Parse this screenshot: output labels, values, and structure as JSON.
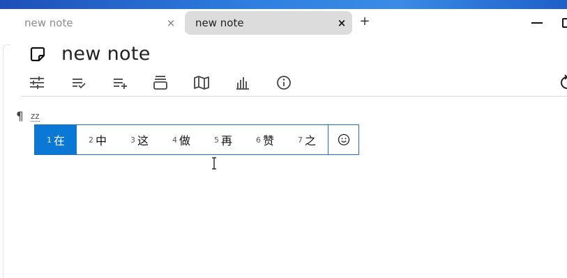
{
  "tabs": [
    {
      "label": "new note",
      "close": "×",
      "active": false
    },
    {
      "label": "new note",
      "close": "×",
      "active": true
    }
  ],
  "new_tab_label": "+",
  "note": {
    "title": "new note"
  },
  "toolbar_icons": [
    "sliders-icon",
    "checklist-icon",
    "add-list-icon",
    "archive-icon",
    "map-icon",
    "bar-chart-icon",
    "info-icon",
    "refresh-icon"
  ],
  "editor": {
    "pilcrow": "¶",
    "composition": "zz"
  },
  "ime": {
    "candidates": [
      {
        "num": "1",
        "char": "在"
      },
      {
        "num": "2",
        "char": "中"
      },
      {
        "num": "3",
        "char": "这"
      },
      {
        "num": "4",
        "char": "做"
      },
      {
        "num": "5",
        "char": "再"
      },
      {
        "num": "6",
        "char": "赞"
      },
      {
        "num": "7",
        "char": "之"
      }
    ],
    "selected_index": 0,
    "emoji_icon": "smiley-icon"
  },
  "colors": {
    "accent": "#0a78d4",
    "border": "#1f6fc4",
    "tab_active_bg": "#dcdcdc"
  }
}
